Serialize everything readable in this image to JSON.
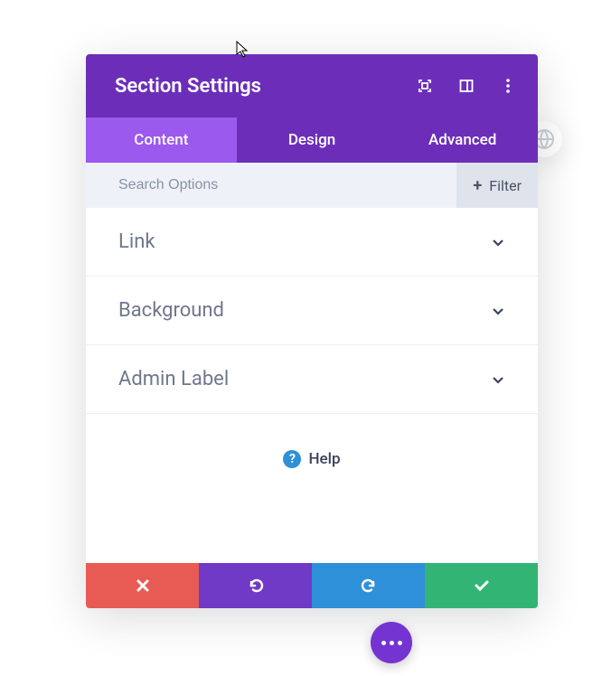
{
  "header": {
    "title": "Section Settings"
  },
  "tabs": [
    {
      "label": "Content",
      "active": true
    },
    {
      "label": "Design",
      "active": false
    },
    {
      "label": "Advanced",
      "active": false
    }
  ],
  "search": {
    "placeholder": "Search Options",
    "filter_label": "Filter"
  },
  "options": [
    {
      "label": "Link"
    },
    {
      "label": "Background"
    },
    {
      "label": "Admin Label"
    }
  ],
  "help": {
    "label": "Help"
  }
}
